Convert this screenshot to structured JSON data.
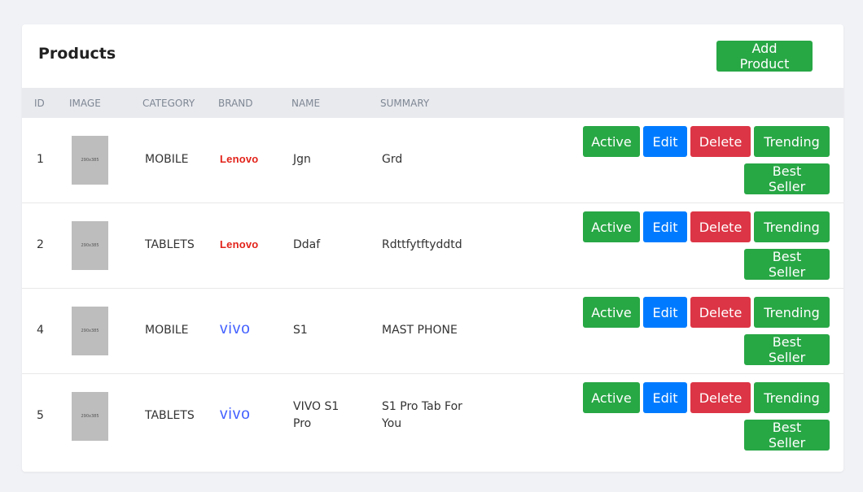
{
  "header": {
    "title": "Products",
    "add_label": "Add Product"
  },
  "table": {
    "columns": [
      "ID",
      "IMAGE",
      "CATEGORY",
      "BRAND",
      "NAME",
      "SUMMARY"
    ],
    "thumb_label": "290x385",
    "action_labels": {
      "active": "Active",
      "edit": "Edit",
      "delete": "Delete",
      "trending": "Trending",
      "best_seller": "Best Seller"
    },
    "rows": [
      {
        "id": "1",
        "category": "MOBILE",
        "brand": "Lenovo",
        "name": [
          "Jgn"
        ],
        "summary": [
          "Grd"
        ]
      },
      {
        "id": "2",
        "category": "TABLETS",
        "brand": "Lenovo",
        "name": [
          "Ddaf"
        ],
        "summary": [
          "Rdttfytftyddtd"
        ]
      },
      {
        "id": "4",
        "category": "MOBILE",
        "brand": "vivo",
        "name": [
          "S1"
        ],
        "summary": [
          "MAST PHONE"
        ]
      },
      {
        "id": "5",
        "category": "TABLETS",
        "brand": "vivo",
        "name": [
          "VIVO S1",
          "Pro"
        ],
        "summary": [
          "S1 Pro Tab For",
          "You"
        ]
      }
    ]
  },
  "colors": {
    "green": "#28a745",
    "blue": "#007bff",
    "red": "#dc3545",
    "lenovo_red": "#e2231a",
    "vivo_blue": "#415fff"
  }
}
